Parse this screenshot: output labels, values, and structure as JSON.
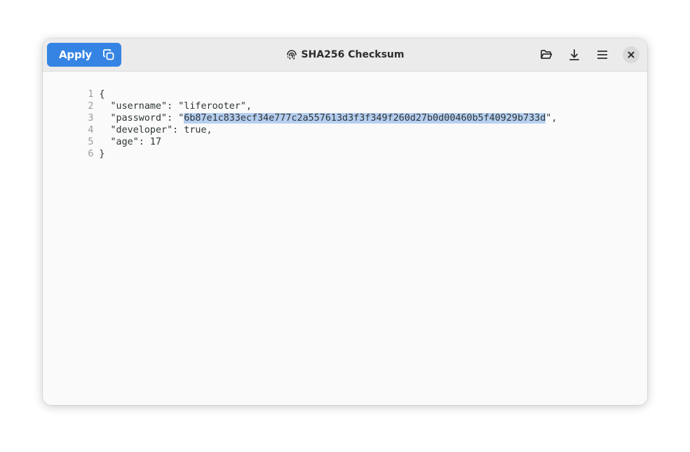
{
  "window": {
    "title": "SHA256 Checksum",
    "title_icon": "fingerprint-icon"
  },
  "headerbar": {
    "apply_label": "Apply",
    "copy_icon": "copy-icon",
    "open_icon": "folder-open-icon",
    "download_icon": "download-icon",
    "menu_icon": "hamburger-menu-icon",
    "close_icon": "close-icon"
  },
  "editor": {
    "lines": [
      {
        "number": "1",
        "text": "{"
      },
      {
        "number": "2",
        "text": "  \"username\": \"liferooter\","
      },
      {
        "number": "3",
        "prefix": "  \"password\": \"",
        "selected": "6b87e1c833ecf34e777c2a557613d3f3f349f260d27b0d00460b5f40929b733d",
        "suffix": "\","
      },
      {
        "number": "4",
        "text": "  \"developer\": true,"
      },
      {
        "number": "5",
        "text": "  \"age\": 17"
      },
      {
        "number": "6",
        "text": "}"
      }
    ]
  },
  "colors": {
    "accent": "#3584e4",
    "selection": "#b5cff0"
  }
}
